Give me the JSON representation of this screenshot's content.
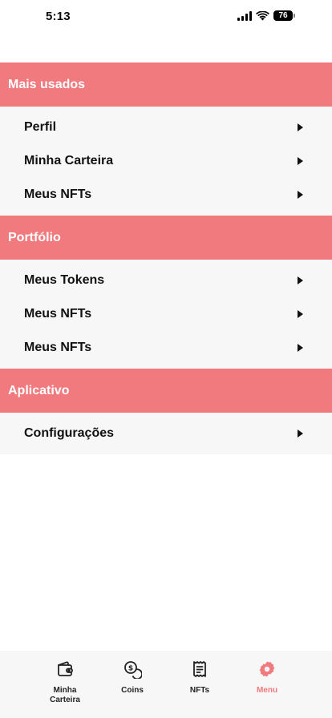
{
  "status_bar": {
    "time": "5:13",
    "battery": "76"
  },
  "sections": [
    {
      "title": "Mais usados",
      "items": [
        "Perfil",
        "Minha Carteira",
        "Meus NFTs"
      ]
    },
    {
      "title": "Portfólio",
      "items": [
        "Meus Tokens",
        "Meus NFTs",
        "Meus NFTs"
      ]
    },
    {
      "title": "Aplicativo",
      "items": [
        "Configurações"
      ]
    }
  ],
  "tab_bar": {
    "tabs": [
      {
        "label": "Minha Carteira",
        "icon": "wallet-icon",
        "active": false
      },
      {
        "label": "Coins",
        "icon": "coins-icon",
        "active": false
      },
      {
        "label": "NFTs",
        "icon": "receipt-icon",
        "active": false
      },
      {
        "label": "Menu",
        "icon": "gear-icon",
        "active": true
      }
    ],
    "active_color": "#f07a7d"
  },
  "colors": {
    "section_header": "#f07a7d",
    "list_background": "#f7f7f7"
  }
}
